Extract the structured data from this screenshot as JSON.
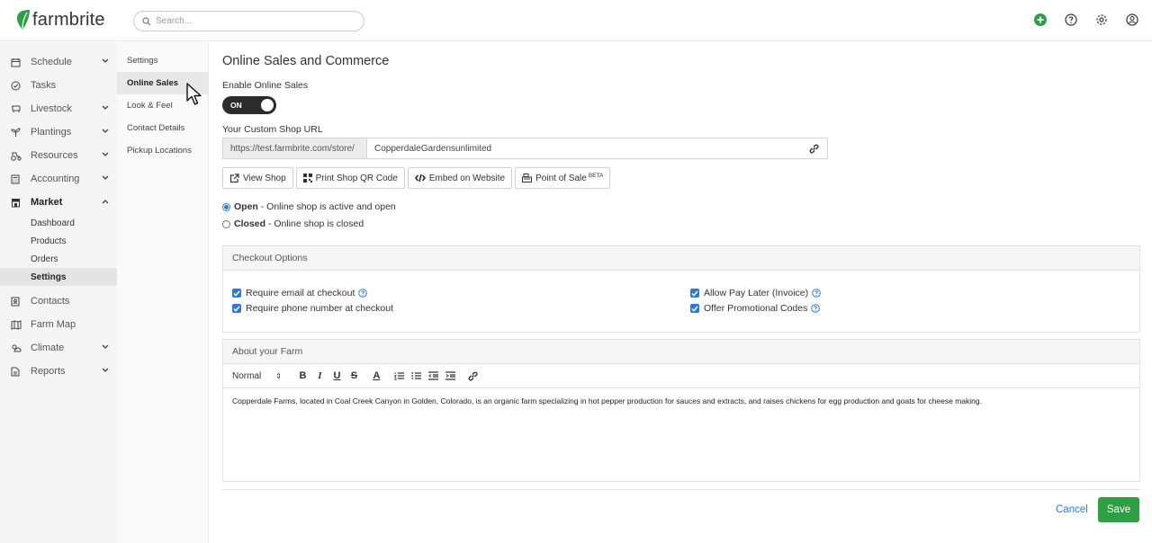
{
  "app": {
    "name": "farmbrite",
    "search_placeholder": "Search...",
    "top_icons": [
      "add-circle-icon",
      "help-icon",
      "settings-gear-icon",
      "account-icon"
    ],
    "brand_color": "#2f9e44",
    "accent_color": "#2b7bd6"
  },
  "sidebar": {
    "items": [
      {
        "label": "Schedule",
        "icon": "calendar-icon",
        "expandable": true
      },
      {
        "label": "Tasks",
        "icon": "check-circle-icon",
        "expandable": false
      },
      {
        "label": "Livestock",
        "icon": "cow-icon",
        "expandable": true
      },
      {
        "label": "Plantings",
        "icon": "sprout-icon",
        "expandable": true
      },
      {
        "label": "Resources",
        "icon": "tractor-icon",
        "expandable": true
      },
      {
        "label": "Accounting",
        "icon": "calculator-icon",
        "expandable": true
      },
      {
        "label": "Market",
        "icon": "store-icon",
        "expanded": true
      },
      {
        "label": "Contacts",
        "icon": "contact-card-icon",
        "expandable": false
      },
      {
        "label": "Farm Map",
        "icon": "map-icon",
        "expandable": false
      },
      {
        "label": "Climate",
        "icon": "cloud-sun-icon",
        "expandable": true
      },
      {
        "label": "Reports",
        "icon": "report-icon",
        "expandable": true
      }
    ],
    "market_subitems": [
      "Dashboard",
      "Products",
      "Orders",
      "Settings"
    ],
    "active_subitem": "Settings"
  },
  "subnav": {
    "items": [
      "Settings",
      "Online Sales",
      "Look & Feel",
      "Contact Details",
      "Pickup Locations"
    ],
    "active": "Online Sales"
  },
  "main": {
    "title": "Online Sales and Commerce",
    "enable_label": "Enable Online Sales",
    "toggle_text": "ON",
    "toggle_on": true,
    "url_label": "Your Custom Shop URL",
    "url_prefix": "https://test.farmbrite.com/store/",
    "url_value": "CopperdaleGardensunlimited",
    "buttons": {
      "view_shop": "View Shop",
      "print_qr": "Print Shop QR Code",
      "embed": "Embed on Website",
      "pos": "Point of Sale",
      "pos_badge": "BETA"
    },
    "status": {
      "open_title": "Open",
      "open_desc": " - Online shop is active and open",
      "closed_title": "Closed",
      "closed_desc": " - Online shop is closed",
      "selected": "Open"
    },
    "checkout": {
      "header": "Checkout Options",
      "options": [
        {
          "label": "Require email at checkout",
          "checked": true,
          "help": true
        },
        {
          "label": "Require phone number at checkout",
          "checked": true,
          "help": false
        },
        {
          "label": "Allow Pay Later (Invoice)",
          "checked": true,
          "help": true
        },
        {
          "label": "Offer Promotional Codes",
          "checked": true,
          "help": true
        }
      ]
    },
    "about": {
      "header": "About your Farm",
      "format_select": "Normal",
      "body": "Copperdale Farms, located in Coal Creek Canyon in Golden, Colorado, is an organic farm specializing in hot pepper production for sauces and extracts, and raises chickens for egg production and goats for cheese making."
    },
    "actions": {
      "cancel": "Cancel",
      "save": "Save"
    }
  }
}
